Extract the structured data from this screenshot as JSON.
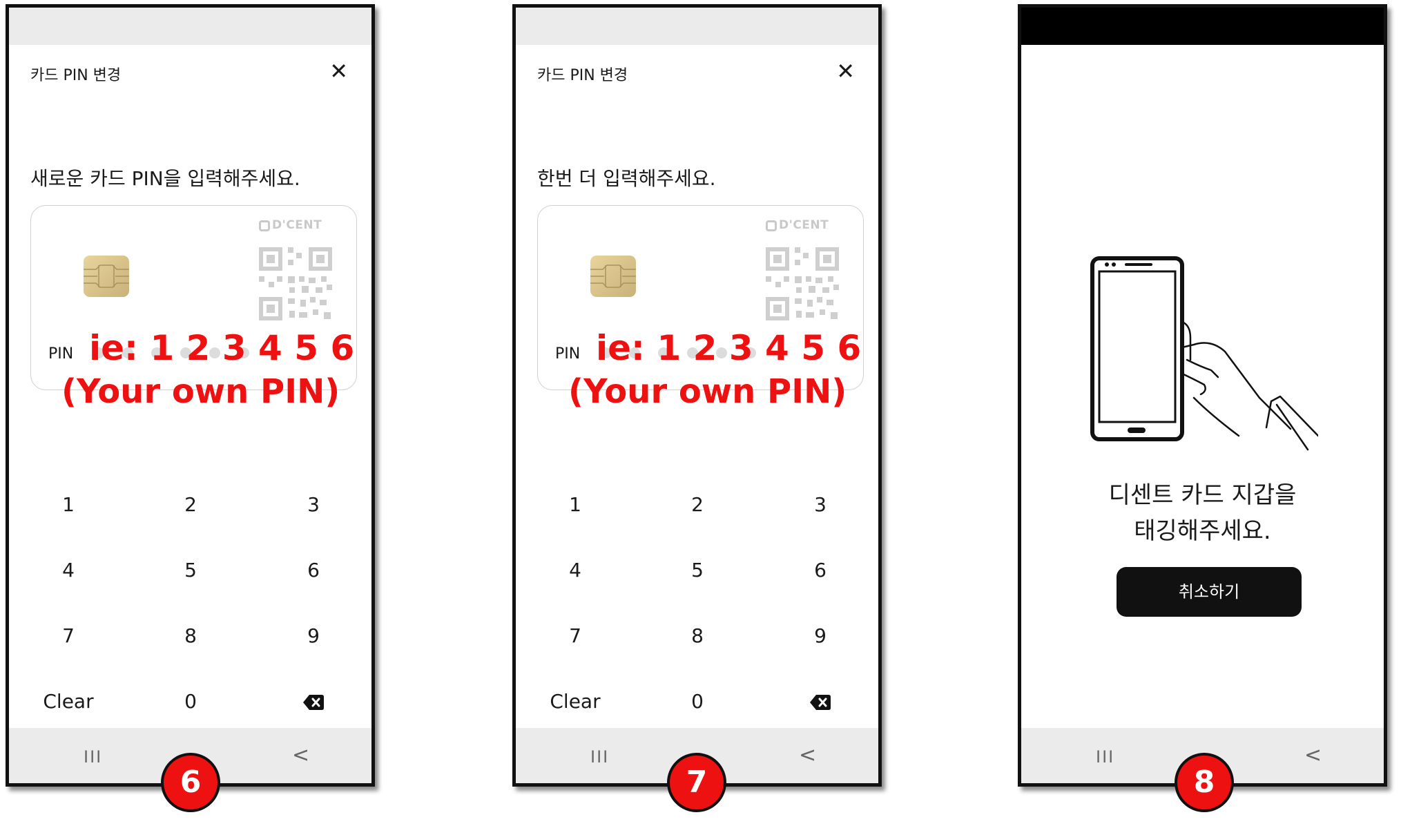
{
  "screens": [
    {
      "step": "6",
      "header_title": "카드 PIN 변경",
      "close_icon": "close-icon",
      "instruction": "새로운 카드 PIN을 입력해주세요.",
      "card": {
        "brand": "D'CENT",
        "pin_label": "PIN"
      },
      "overlay": {
        "line1": "ie: 1 2 3 4 5 6",
        "line2": "(Your own PIN)",
        "color": "#ee1111"
      }
    },
    {
      "step": "7",
      "header_title": "카드 PIN 변경",
      "close_icon": "close-icon",
      "instruction": "한번 더 입력해주세요.",
      "card": {
        "brand": "D'CENT",
        "pin_label": "PIN"
      },
      "overlay": {
        "line1": "ie: 1 2 3 4 5 6",
        "line2": "(Your own PIN)",
        "color": "#ee1111"
      }
    },
    {
      "step": "8",
      "tag_message_line1": "디센트 카드 지갑을",
      "tag_message_line2": "태깅해주세요.",
      "cancel_label": "취소하기"
    }
  ],
  "keypad": {
    "keys": [
      "1",
      "2",
      "3",
      "4",
      "5",
      "6",
      "7",
      "8",
      "9",
      "Clear",
      "0"
    ],
    "backspace_icon": "backspace-icon"
  },
  "navbar": {
    "recents": "III",
    "back": "<"
  },
  "colors": {
    "badge": "#ee1111",
    "button": "#111111",
    "bar": "#ebebeb"
  }
}
